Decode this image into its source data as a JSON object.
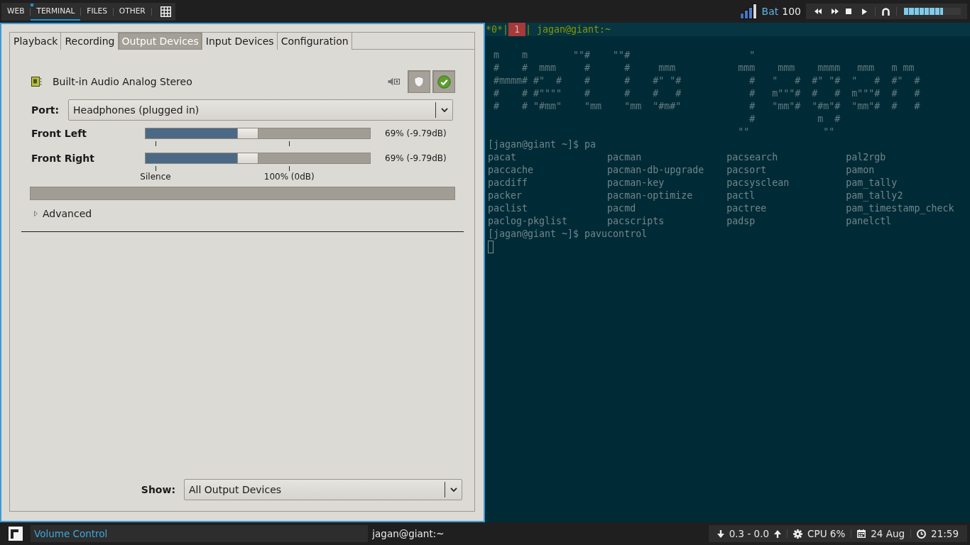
{
  "top_bar": {
    "workspaces": [
      {
        "label": "WEB",
        "selected": false,
        "occupied": false
      },
      {
        "label": "TERMINAL",
        "selected": true,
        "occupied": true
      },
      {
        "label": "FILES",
        "selected": false,
        "occupied": false
      },
      {
        "label": "OTHER",
        "selected": false,
        "occupied": false
      }
    ],
    "battery": {
      "label": "Bat",
      "value": "100"
    },
    "volume": {
      "level": 0.69
    }
  },
  "volume_control": {
    "tabs": [
      {
        "label": "Playback",
        "selected": false
      },
      {
        "label": "Recording",
        "selected": false
      },
      {
        "label": "Output Devices",
        "selected": true
      },
      {
        "label": "Input Devices",
        "selected": false
      },
      {
        "label": "Configuration",
        "selected": false
      }
    ],
    "device": {
      "name": "Built-in Audio Analog Stereo",
      "mute_on": false,
      "lock_on": true,
      "default_on": true
    },
    "port": {
      "label": "Port:",
      "value": "Headphones (plugged in)"
    },
    "channels": [
      {
        "name": "Front Left",
        "level": 0.45,
        "reading": "69% (-9.79dB)"
      },
      {
        "name": "Front Right",
        "level": 0.45,
        "reading": "69% (-9.79dB)"
      }
    ],
    "scale_labels": [
      "Silence",
      "100% (0dB)"
    ],
    "advanced": {
      "label": "Advanced",
      "expanded": false
    },
    "show": {
      "label": "Show:",
      "value": "All Output Devices"
    }
  },
  "terminal": {
    "status": [
      {
        "text": "*0*|",
        "selected": false
      },
      {
        "text": "1",
        "selected": true
      },
      {
        "text": "| jagan@giant:~",
        "selected": false
      }
    ],
    "banner": [
      " m    m        \"\"#    \"\"#                     \"",
      " #    #  mmm     #      #     mmm           mmm    mmm    mmmm   mmm   m mm",
      " #mmmm# #\"  #    #      #    #\" \"#            #   \"   #  #\" \"#  \"   #  #\"  #",
      " #    # #\"\"\"\"    #      #    #   #            #   m\"\"\"#  #   #  m\"\"\"#  #   #",
      " #    # \"#mm\"    \"mm    \"mm  \"#m#\"            #   \"mm\"#  \"#m\"#  \"mm\"#  #   #",
      "                                              #           m  #",
      "                                            \"\"             \"\""
    ],
    "lines": [
      {
        "kind": "prompt",
        "text": "[jagan@giant ~]$ pa"
      },
      {
        "kind": "columns",
        "rows": [
          [
            "pacat",
            "pacman",
            "pacsearch",
            "pal2rgb"
          ],
          [
            "paccache",
            "pacman-db-upgrade",
            "pacsort",
            "pamon"
          ],
          [
            "pacdiff",
            "pacman-key",
            "pacsysclean",
            "pam_tally"
          ],
          [
            "packer",
            "pacman-optimize",
            "pactl",
            "pam_tally2"
          ],
          [
            "paclist",
            "pacmd",
            "pactree",
            "pam_timestamp_check"
          ],
          [
            "paclog-pkglist",
            "pacscripts",
            "padsp",
            "panelctl"
          ]
        ]
      },
      {
        "kind": "prompt",
        "text": "[jagan@giant ~]$ pavucontrol"
      }
    ]
  },
  "bottom_bar": {
    "tasks": [
      {
        "title": "Volume Control",
        "selected": true
      },
      {
        "title": "jagan@giant:~",
        "selected": false
      }
    ],
    "widgets": [
      {
        "kind": "network",
        "text": "0.3 - 0.0"
      },
      {
        "kind": "cpu",
        "text": "CPU 6%"
      },
      {
        "kind": "date",
        "text": "24 Aug"
      },
      {
        "kind": "clock",
        "text": "21:59"
      }
    ]
  }
}
